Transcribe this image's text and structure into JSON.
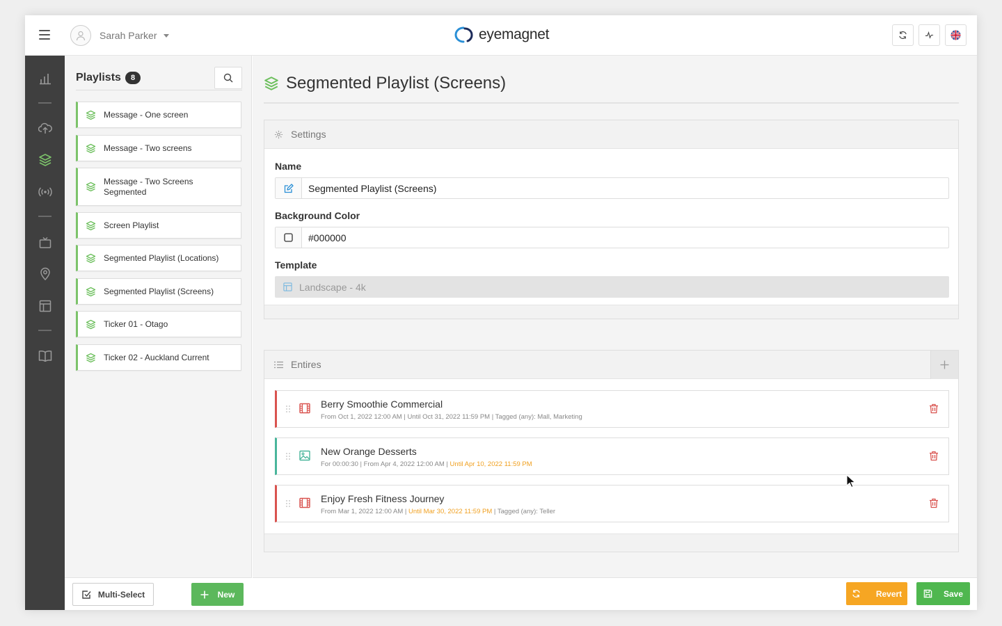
{
  "header": {
    "user_name": "Sarah Parker",
    "logo_text": "eyemagnet",
    "icons": [
      "hamburger-icon",
      "user-avatar-icon",
      "caret-down-icon",
      "refresh-icon",
      "activity-icon",
      "uk-flag-icon"
    ]
  },
  "nav": {
    "icons": [
      "bar-chart-icon",
      "cloud-upload-icon",
      "layers-icon",
      "broadcast-icon",
      "tv-icon",
      "map-pin-icon",
      "layout-icon",
      "book-icon"
    ],
    "active": "layers-icon"
  },
  "playlists": {
    "title": "Playlists",
    "count": "8",
    "items": [
      {
        "label": "Message - One screen"
      },
      {
        "label": "Message - Two screens"
      },
      {
        "label": "Message - Two Screens Segmented"
      },
      {
        "label": "Screen Playlist"
      },
      {
        "label": "Segmented Playlist (Locations)"
      },
      {
        "label": "Segmented Playlist (Screens)"
      },
      {
        "label": "Ticker 01 - Otago"
      },
      {
        "label": "Ticker 02 - Auckland Current"
      }
    ],
    "multi_select_label": "Multi-Select",
    "new_label": "New"
  },
  "main": {
    "title": "Segmented Playlist (Screens)",
    "settings": {
      "heading": "Settings",
      "name_label": "Name",
      "name_value": "Segmented Playlist (Screens)",
      "bg_label": "Background Color",
      "bg_value": "#000000",
      "template_label": "Template",
      "template_value": "Landscape - 4k"
    },
    "entries": {
      "heading": "Entires",
      "items": [
        {
          "title": "Berry Smoothie Commercial",
          "meta_a": "From Oct 1, 2022 12:00 AM  |  Until Oct 31, 2022 11:59 PM | Tagged (any): Mall, Marketing",
          "meta_warn": "",
          "meta_b": "",
          "type": "film-icon"
        },
        {
          "title": "New Orange Desserts",
          "meta_a": "For 00:00:30  |  From Apr 4, 2022 12:00 AM  |  ",
          "meta_warn": "Until Apr 10, 2022 11:59 PM",
          "meta_b": "",
          "type": "image-icon"
        },
        {
          "title": "Enjoy Fresh Fitness Journey",
          "meta_a": "From Mar 1, 2022 12:00 AM  |  ",
          "meta_warn": "Until Mar 30, 2022 11:59 PM",
          "meta_b": " | Tagged (any): Teller",
          "type": "film-icon"
        }
      ]
    }
  },
  "footer": {
    "revert_label": "Revert",
    "save_label": "Save"
  },
  "colors": {
    "accent_green": "#5cb85c",
    "revert_orange": "#f6a623",
    "danger_red": "#d9534f",
    "teal": "#49b59b",
    "sidebar_dark": "#3f3f3f",
    "logo_blue": "#2a8fd6"
  }
}
